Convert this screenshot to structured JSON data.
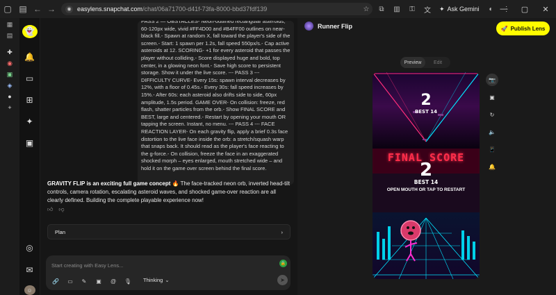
{
  "browser": {
    "url_domain": "easylens.snapchat.com",
    "url_path": "/chat/06a71700-d41f-73fa-8000-bbd37fdf139",
    "ask_gemini": "Ask Gemini"
  },
  "chat": {
    "user_message": "PASS 2 — OBSTACLES- Neon-outlined rectangular asteroids, 60-120px wide, vivid #FF4D00 and #B4FF00 outlines on near-black fill.- Spawn at random X, fall toward the player's side of the screen.- Start: 1 spawn per 1.2s, fall speed 550px/s.- Cap active asteroids at 12. SCORING- +1 for every asteroid that passes the player without colliding.- Score displayed huge and bold, top center, in a glowing neon font.- Save high score to persistent storage. Show it under the live score. --- PASS 3 --- DIFFICULTY CURVE- Every 15s: spawn interval decreases by 12%, with a floor of 0.45s.- Every 30s: fall speed increases by 15%.- After 60s: each asteroid also drifts side to side, 60px amplitude, 1.5s period. GAME OVER- On collision: freeze, red flash, shatter particles from the orb.- Show FINAL SCORE and BEST, large and centered.- Restart by opening your mouth OR tapping the screen. Instant, no menu. --- PASS 4 --- FACE REACTION LAYER- On each gravity flip, apply a brief 0.3s face distortion to the live face inside the orb: a stretch/squash warp that snaps back. It should read as the player's face reacting to the g-force.- On collision, freeze the face in an exaggerated shocked morph – eyes enlarged, mouth stretched wide – and hold it on the game over screen behind the final score.",
    "reply_head": "GRAVITY FLIP is an exciting full game concept 🔥",
    "reply_body": " The face-tracked neon orb, inverted head-tilt controls, camera rotation, escalating asteroid waves, and shocked game-over reaction are all clearly defined. Building the complete playable experience now!",
    "plan_label": "Plan",
    "composer_placeholder": "Start creating with Easy Lens...",
    "thinking_label": "Thinking"
  },
  "preview": {
    "lens_name": "Runner Flip",
    "publish_label": "Publish Lens",
    "tab_preview": "Preview",
    "tab_edit": "Edit",
    "game": {
      "top_score": "2",
      "top_best": "BEST 14",
      "final_score_label": "FINAL SCORE",
      "final_score": "2",
      "final_best": "BEST 14",
      "restart_hint": "OPEN MOUTH OR TAP TO RESTART"
    }
  },
  "colors": {
    "publish_yellow": "#fffc00",
    "neon_pink": "#ff2d7a",
    "neon_cyan": "#00f0ff",
    "final_red": "#ff2d4a"
  }
}
